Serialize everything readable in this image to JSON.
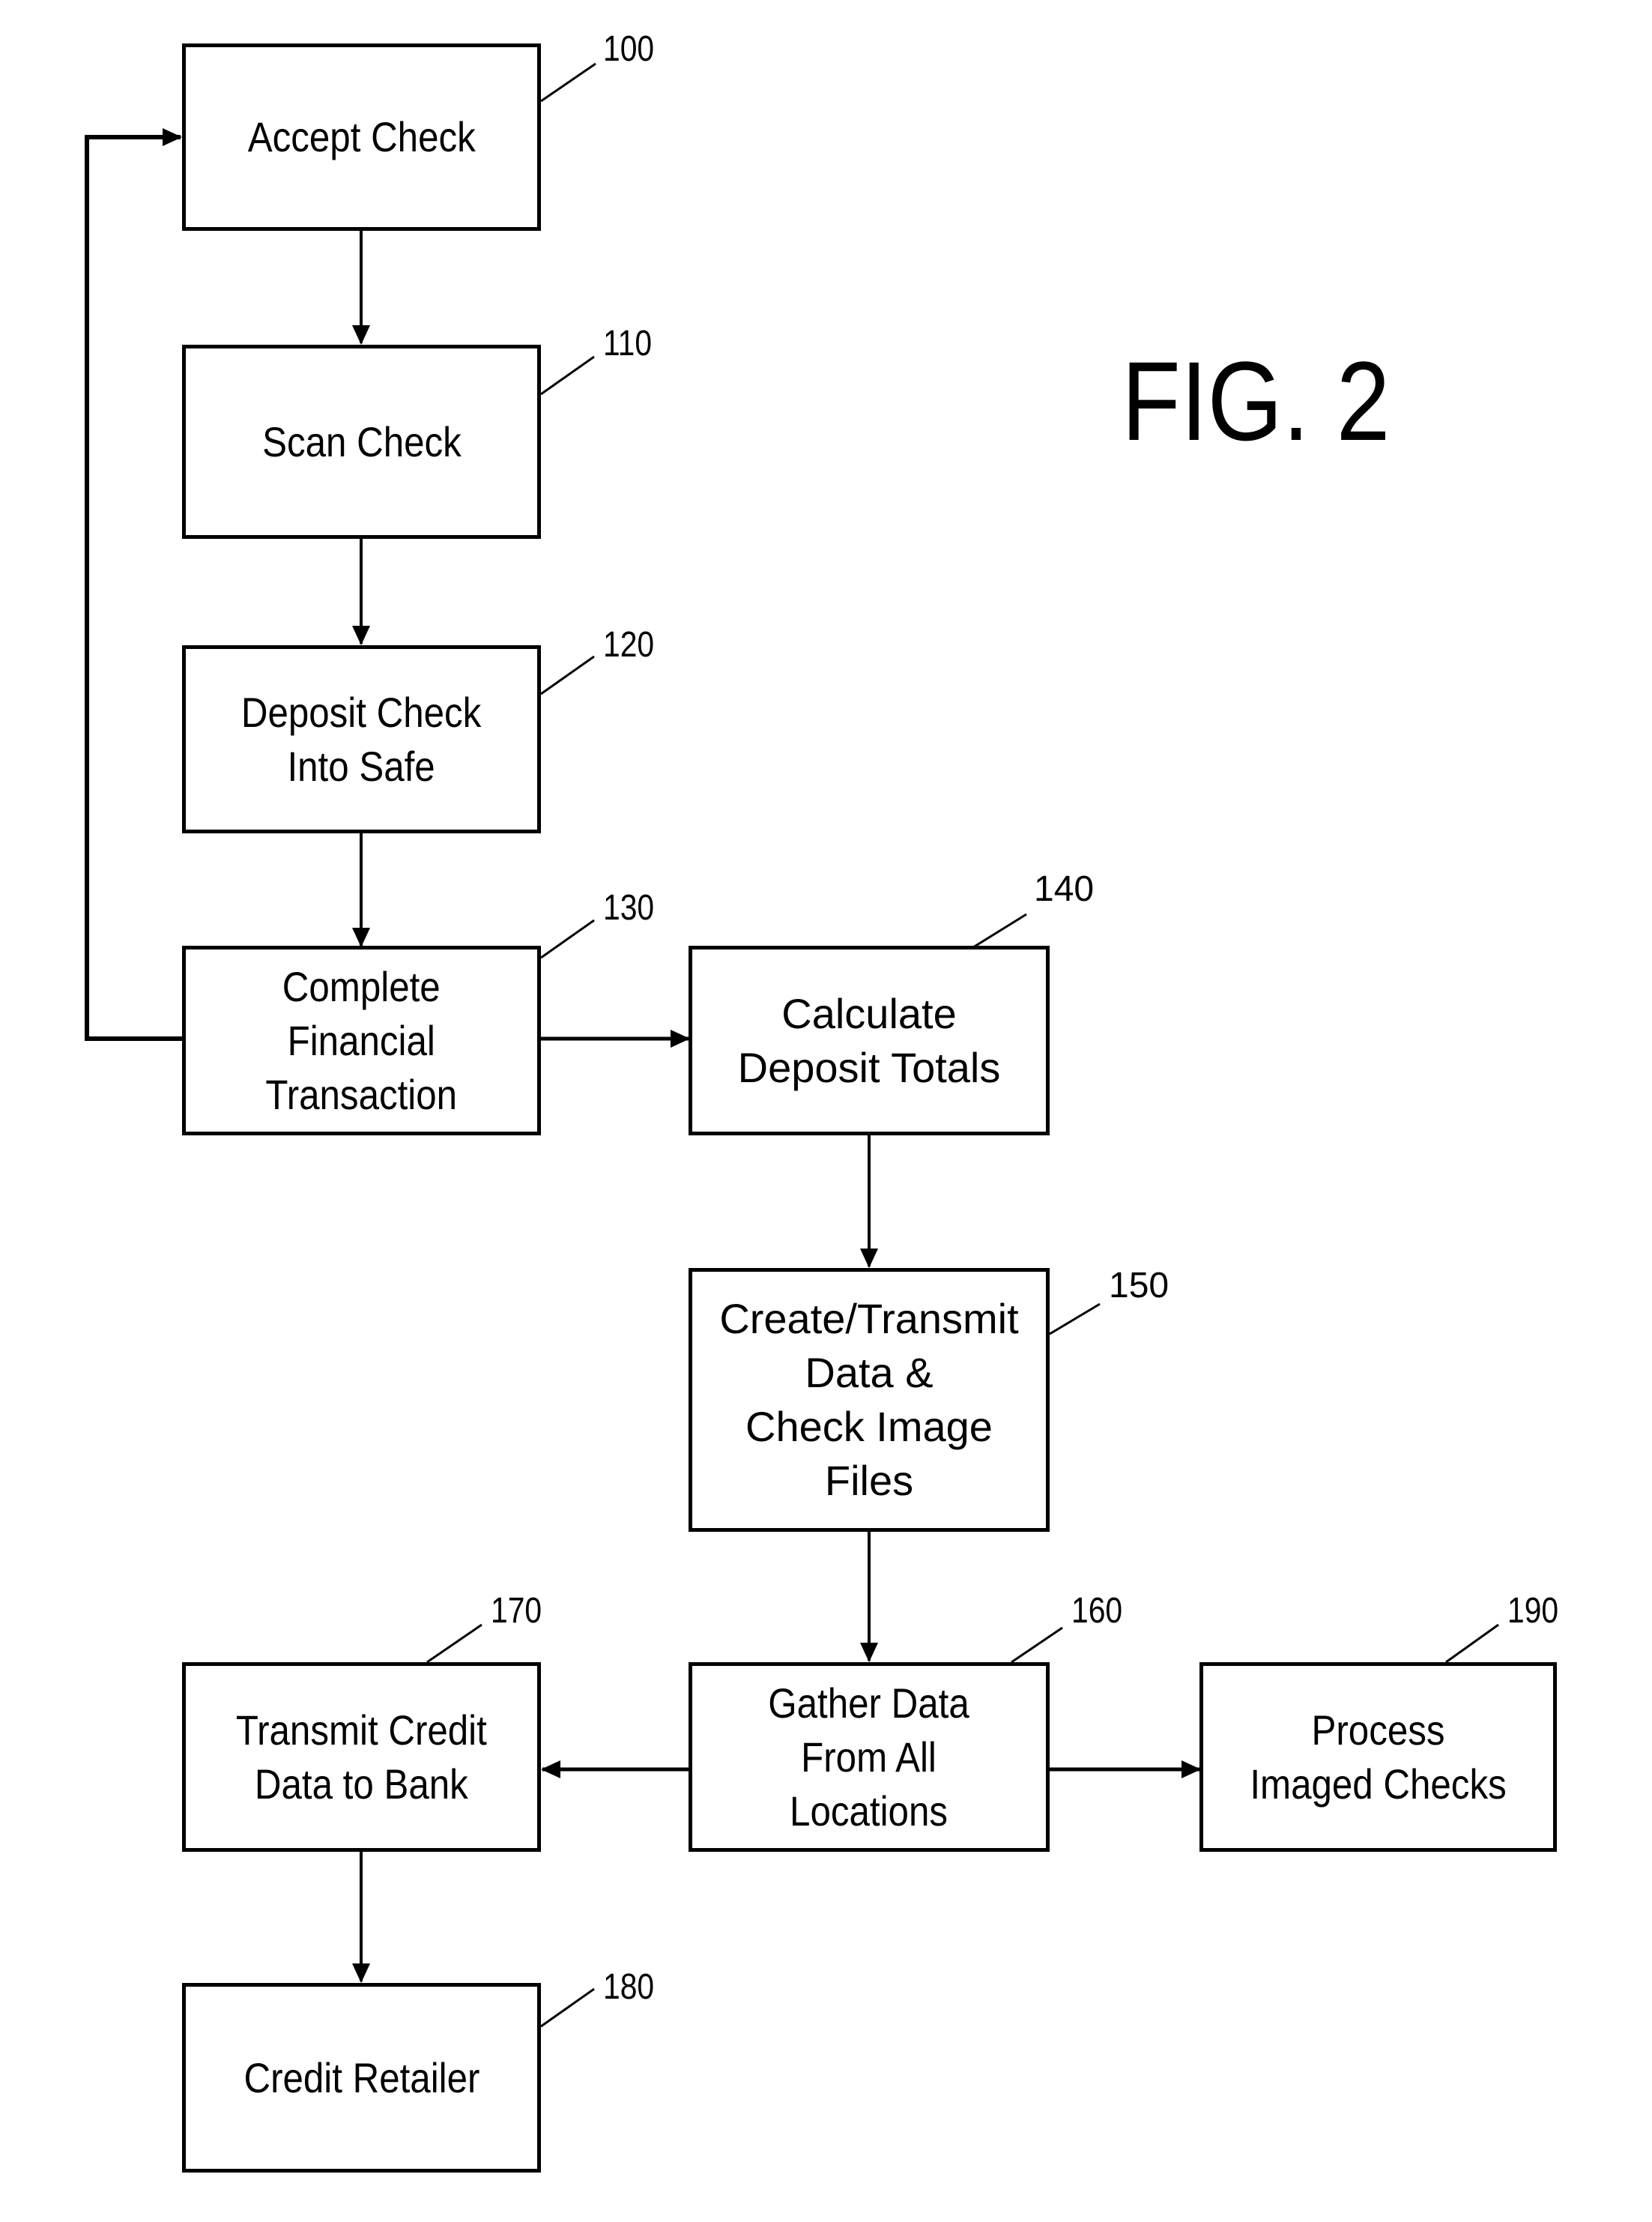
{
  "figure_title": "FIG. 2",
  "steps": [
    {
      "id": "100",
      "label": "Accept Check"
    },
    {
      "id": "110",
      "label": "Scan Check"
    },
    {
      "id": "120",
      "label": "Deposit Check\nInto Safe"
    },
    {
      "id": "130",
      "label": "Complete\nFinancial\nTransaction"
    },
    {
      "id": "140",
      "label": "Calculate\nDeposit Totals"
    },
    {
      "id": "150",
      "label": "Create/Transmit\nData &\nCheck Image\nFiles"
    },
    {
      "id": "160",
      "label": "Gather Data\nFrom All\nLocations"
    },
    {
      "id": "170",
      "label": "Transmit Credit\nData to Bank"
    },
    {
      "id": "180",
      "label": "Credit Retailer"
    },
    {
      "id": "190",
      "label": "Process\nImaged Checks"
    }
  ],
  "connections": [
    {
      "from": "100",
      "to": "110"
    },
    {
      "from": "110",
      "to": "120"
    },
    {
      "from": "120",
      "to": "130"
    },
    {
      "from": "130",
      "to": "100",
      "type": "loop"
    },
    {
      "from": "130",
      "to": "140"
    },
    {
      "from": "140",
      "to": "150"
    },
    {
      "from": "150",
      "to": "160"
    },
    {
      "from": "160",
      "to": "170"
    },
    {
      "from": "160",
      "to": "190"
    },
    {
      "from": "170",
      "to": "180"
    }
  ]
}
